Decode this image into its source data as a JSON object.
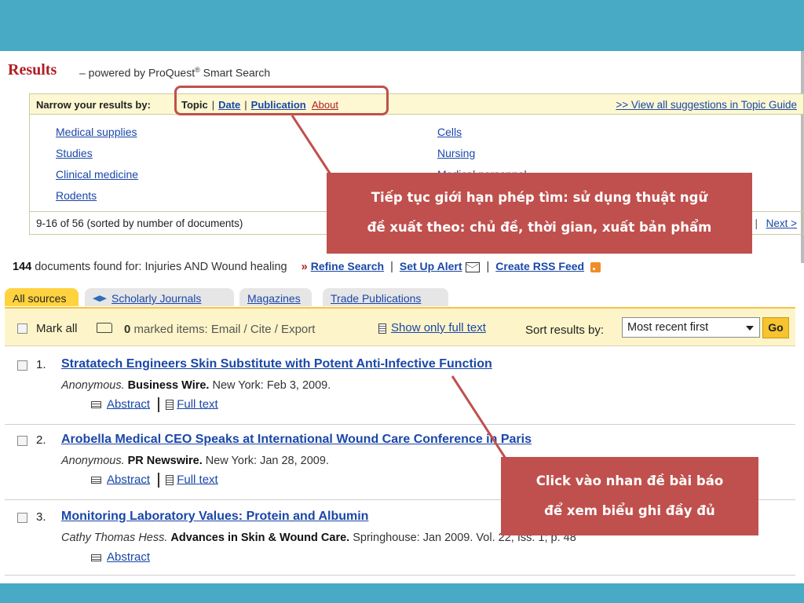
{
  "results_header": {
    "title": "Results",
    "subtitle": "– powered by ProQuest",
    "subtitle_mark": "®",
    "subtitle_tail": " Smart Search"
  },
  "narrow": {
    "label": "Narrow your results by:",
    "tabs": [
      "Topic",
      "Date",
      "Publication",
      "About"
    ],
    "separator": "|",
    "view_all": ">> View all suggestions in Topic Guide"
  },
  "topics": {
    "left": [
      "Medical supplies",
      "Studies",
      "Clinical medicine",
      "Rodents"
    ],
    "right": [
      "Cells",
      "Nursing",
      "Medical personnel"
    ]
  },
  "pager": {
    "range_text": "9-16 of 56 (sorted by number of documents)",
    "separator": "|",
    "next": "Next >"
  },
  "callouts": {
    "narrow_note_line1": "Tiếp tục giới hạn phép tìm: sử dụng thuật ngữ",
    "narrow_note_line2": "đề xuất theo: chủ đề, thời gian, xuất bản phẩm",
    "click_note_line1": "Click vào nhan đề bài báo",
    "click_note_line2": "để xem biểu ghi đầy đủ"
  },
  "found": {
    "count": "144",
    "text": "documents found for: Injuries AND Wound healing",
    "arrow": "»",
    "refine": "Refine Search",
    "alert": "Set Up Alert",
    "rss": "Create RSS Feed",
    "separator": "|"
  },
  "source_tabs": [
    "All sources",
    "Scholarly Journals",
    "Magazines",
    "Trade Publications"
  ],
  "actions": {
    "mark_all": "Mark all",
    "marked_count": "0",
    "marked_text": "marked items: Email / Cite / Export",
    "show_full_text": "Show only full text",
    "sort_label": "Sort results by:",
    "sort_value": "Most recent first",
    "go": "Go"
  },
  "results": [
    {
      "num": "1.",
      "title": "Stratatech Engineers Skin Substitute with Potent Anti-Infective Function",
      "author": "Anonymous.",
      "publication": "Business Wire.",
      "details": "New York: Feb 3, 2009.",
      "abstract": "Abstract",
      "full_text": "Full text"
    },
    {
      "num": "2.",
      "title": "Arobella Medical CEO Speaks at International Wound Care Conference in Paris",
      "author": "Anonymous.",
      "publication": "PR Newswire.",
      "details": "New York: Jan 28, 2009.",
      "abstract": "Abstract",
      "full_text": "Full text"
    },
    {
      "num": "3.",
      "title": "Monitoring Laboratory Values: Protein and Albumin",
      "author": "Cathy Thomas Hess.",
      "publication": "Advances in Skin & Wound Care.",
      "details": "Springhouse: Jan 2009. Vol. 22, Iss. 1; p. 48",
      "abstract": "Abstract"
    }
  ],
  "colors": {
    "frame": "#48aac4",
    "callout": "#c0504d",
    "link": "#1a47a8",
    "brand_red": "#b01e23",
    "highlight_bar": "#fdf5c9",
    "active_tab": "#ffd33f"
  }
}
